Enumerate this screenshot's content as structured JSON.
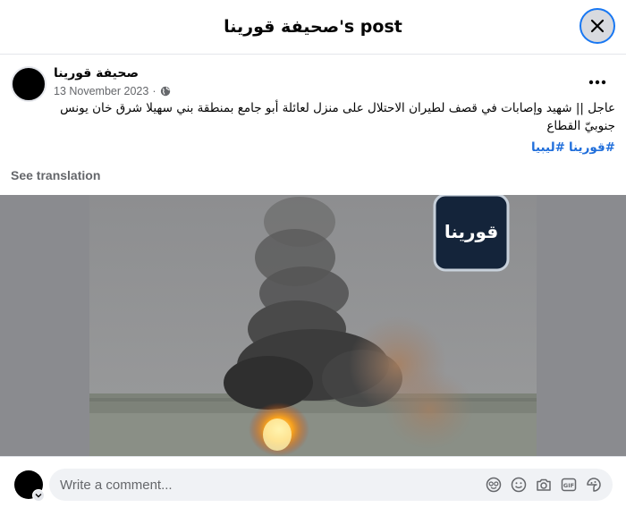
{
  "dialog": {
    "title": "صحيفة قورينا's post"
  },
  "post": {
    "author": "صحيفة قورينا",
    "date": "13 November 2023",
    "separator": "·",
    "privacy_icon": "globe-icon",
    "text_line1": "عاجل || شهيد وإصابات في قصف لطيران الاحتلال على منزل لعائلة أبو جامع بمنطقة بني سهيلا شرق خان يونس",
    "text_line2": "جنوبيّ القطاع",
    "hashtags": [
      "#قورينا",
      "#ليبيا"
    ],
    "see_translation": "See translation",
    "image_logo_text": "قورينا"
  },
  "comment": {
    "placeholder": "Write a comment...",
    "tools": [
      "avatar-sticker-icon",
      "emoji-icon",
      "camera-icon",
      "gif-icon",
      "sticker-icon"
    ]
  },
  "colors": {
    "link": "#216fdb",
    "accent": "#1877f2",
    "muted": "#65676b"
  }
}
